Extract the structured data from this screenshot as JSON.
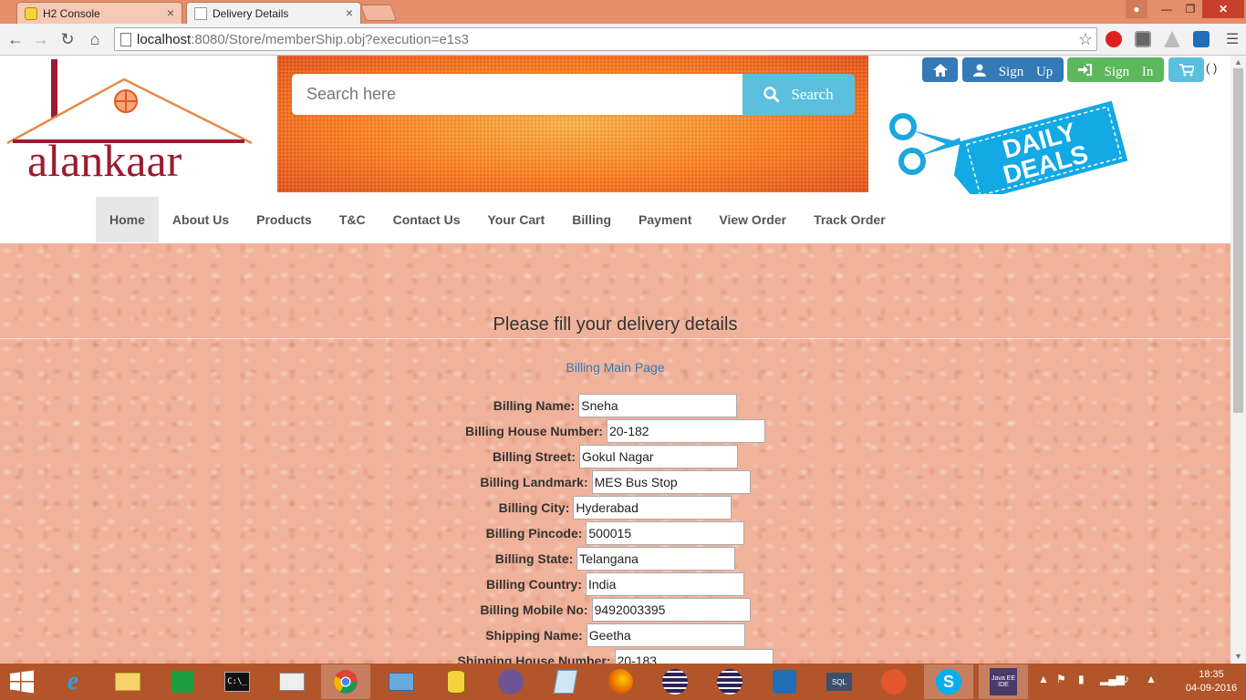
{
  "browser": {
    "tabs": [
      {
        "label": "H2 Console",
        "active": false
      },
      {
        "label": "Delivery Details",
        "active": true
      }
    ],
    "url_host": "localhost",
    "url_path": ":8080/Store/memberShip.obj?execution=e1s3"
  },
  "header": {
    "logo_text": "alankaar",
    "search_placeholder": "Search here",
    "search_button": "Search",
    "signup_label": "Sign Up",
    "signin_label": "Sign In",
    "cart_count": "( )",
    "deals_line1": "DAILY",
    "deals_line2": "DEALS"
  },
  "nav": {
    "items": [
      "Home",
      "About Us",
      "Products",
      "T&C",
      "Contact Us",
      "Your Cart",
      "Billing",
      "Payment",
      "View Order",
      "Track Order"
    ],
    "active": "Home"
  },
  "main": {
    "heading": "Please fill your delivery details",
    "billing_link": "Billing Main Page",
    "fields": [
      {
        "label": "Billing Name:",
        "value": "Sneha"
      },
      {
        "label": "Billing House Number:",
        "value": "20-182"
      },
      {
        "label": "Billing Street:",
        "value": "Gokul Nagar"
      },
      {
        "label": "Billing Landmark:",
        "value": "MES Bus Stop"
      },
      {
        "label": "Billing City:",
        "value": "Hyderabad"
      },
      {
        "label": "Billing Pincode:",
        "value": "500015"
      },
      {
        "label": "Billing State:",
        "value": "Telangana"
      },
      {
        "label": "Billing Country:",
        "value": "India"
      },
      {
        "label": "Billing Mobile No:",
        "value": "9492003395"
      },
      {
        "label": "Shipping Name:",
        "value": "Geetha"
      },
      {
        "label": "Shipping House Number:",
        "value": "20-183"
      }
    ]
  },
  "taskbar": {
    "time": "18:35",
    "date": "04-09-2016",
    "java_label": "Java EE IDE"
  },
  "colors": {
    "chrome_frame": "#e58e6a",
    "primary": "#337ab7",
    "success": "#5cb85c",
    "info": "#5bc0de",
    "logo_red": "#9b1b30"
  }
}
